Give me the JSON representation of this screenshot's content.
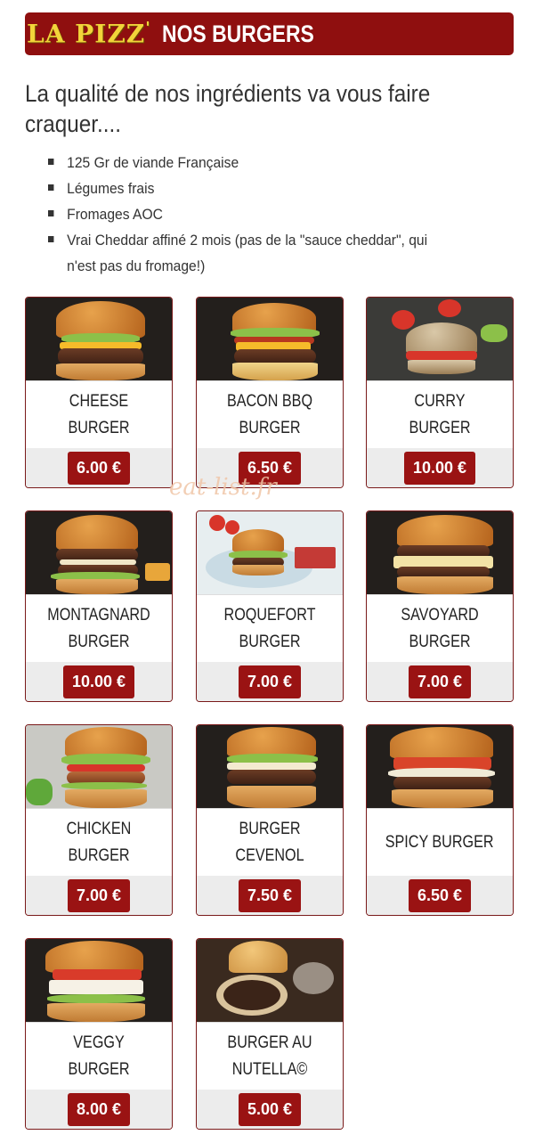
{
  "header": {
    "logo_text": "LA PIZZ",
    "logo_mark": "'",
    "title": "NOS BURGERS",
    "colors": {
      "bar": "#8f0f0f",
      "logo": "#f2d43a"
    }
  },
  "intro": {
    "tagline": "La qualité de nos ingrédients va vous faire craquer....",
    "features": [
      "125 Gr de viande Française",
      "Légumes frais",
      "Fromages AOC",
      "Vrai Cheddar affiné 2 mois (pas de la \"sauce cheddar\", qui n'est pas du fromage!)"
    ]
  },
  "watermark": "eat-list.fr",
  "price_color": "#9a1313",
  "burgers": [
    {
      "name": "CHEESE BURGER",
      "price": "6.00 €"
    },
    {
      "name": "BACON BBQ BURGER",
      "price": "6.50 €"
    },
    {
      "name": "CURRY BURGER",
      "price": "10.00 €"
    },
    {
      "name": "MONTAGNARD BURGER",
      "price": "10.00 €"
    },
    {
      "name": "ROQUEFORT BURGER",
      "price": "7.00 €"
    },
    {
      "name": "SAVOYARD BURGER",
      "price": "7.00 €"
    },
    {
      "name": "CHICKEN BURGER",
      "price": "7.00 €"
    },
    {
      "name": "BURGER CEVENOL",
      "price": "7.50 €"
    },
    {
      "name": "SPICY BURGER",
      "price": "6.50 €"
    },
    {
      "name": "VEGGY BURGER",
      "price": "8.00 €"
    },
    {
      "name": "BURGER AU NUTELLA©",
      "price": "5.00 €"
    }
  ]
}
